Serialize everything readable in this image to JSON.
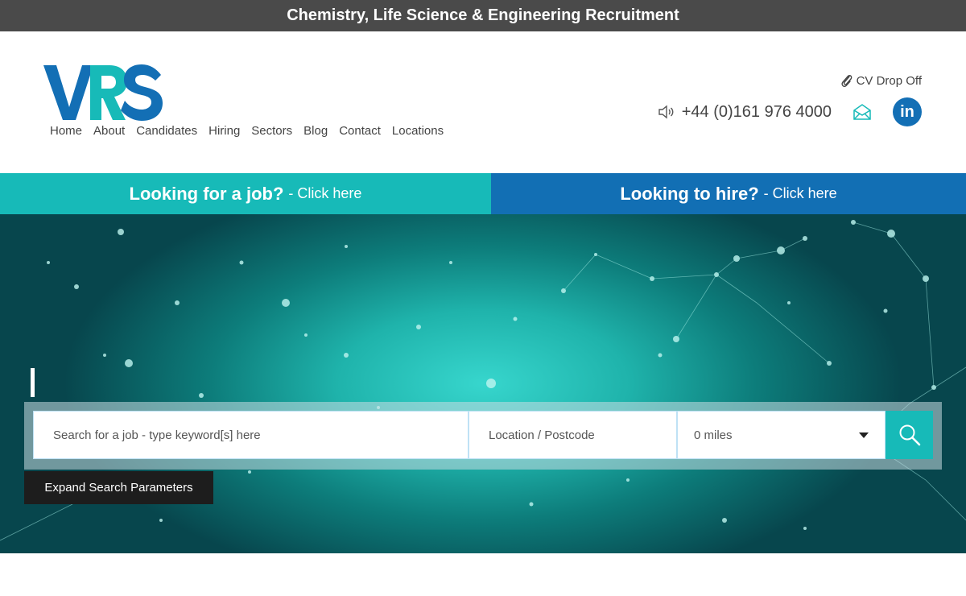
{
  "topbar": {
    "title": "Chemistry, Life Science & Engineering Recruitment"
  },
  "header": {
    "logo_text": "VRS",
    "nav": [
      "Home",
      "About",
      "Candidates",
      "Hiring",
      "Sectors",
      "Blog",
      "Contact",
      "Locations"
    ],
    "cv_drop_off": "CV Drop Off",
    "phone": "+44 (0)161 976 4000",
    "linkedin_label": "in"
  },
  "cta": {
    "job_strong": "Looking for a job?",
    "job_light": "- Click here",
    "hire_strong": "Looking to hire?",
    "hire_light": "- Click here"
  },
  "search": {
    "keyword_placeholder": "Search for a job - type keyword[s] here",
    "location_placeholder": "Location / Postcode",
    "miles_value": "0 miles",
    "expand_label": "Expand Search Parameters"
  },
  "colors": {
    "teal": "#17bab8",
    "blue": "#126fb4",
    "topbar": "#4a4a4a",
    "dark_button": "#1d1d1d"
  }
}
